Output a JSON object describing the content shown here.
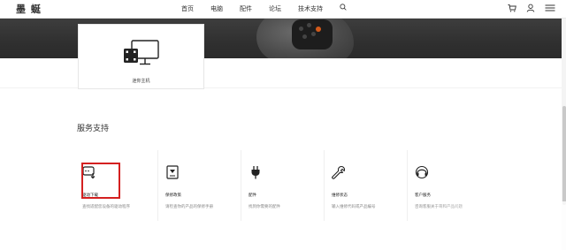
{
  "header": {
    "logo": "墨 蜒",
    "nav": [
      "首页",
      "电脑",
      "配件",
      "论坛",
      "技术支持"
    ]
  },
  "product": {
    "label": "迷你主机"
  },
  "section": {
    "title": "服务支持"
  },
  "services": [
    {
      "name": "驱动下载",
      "desc": "查找适配您设备的驱动程序",
      "icon": "driver-download-icon"
    },
    {
      "name": "保修政策",
      "desc": "请检查你的产品的保修手册",
      "icon": "warranty-document-icon"
    },
    {
      "name": "配件",
      "desc": "找到你需要的配件",
      "icon": "plug-icon"
    },
    {
      "name": "维修状态",
      "desc": "输入维修代码或产品编号",
      "icon": "wrench-icon"
    },
    {
      "name": "客户服务",
      "desc": "咨询客服关于哥和产品问题",
      "icon": "headset-icon"
    }
  ],
  "colors": {
    "highlight": "#d42020",
    "hero": "#333333"
  }
}
